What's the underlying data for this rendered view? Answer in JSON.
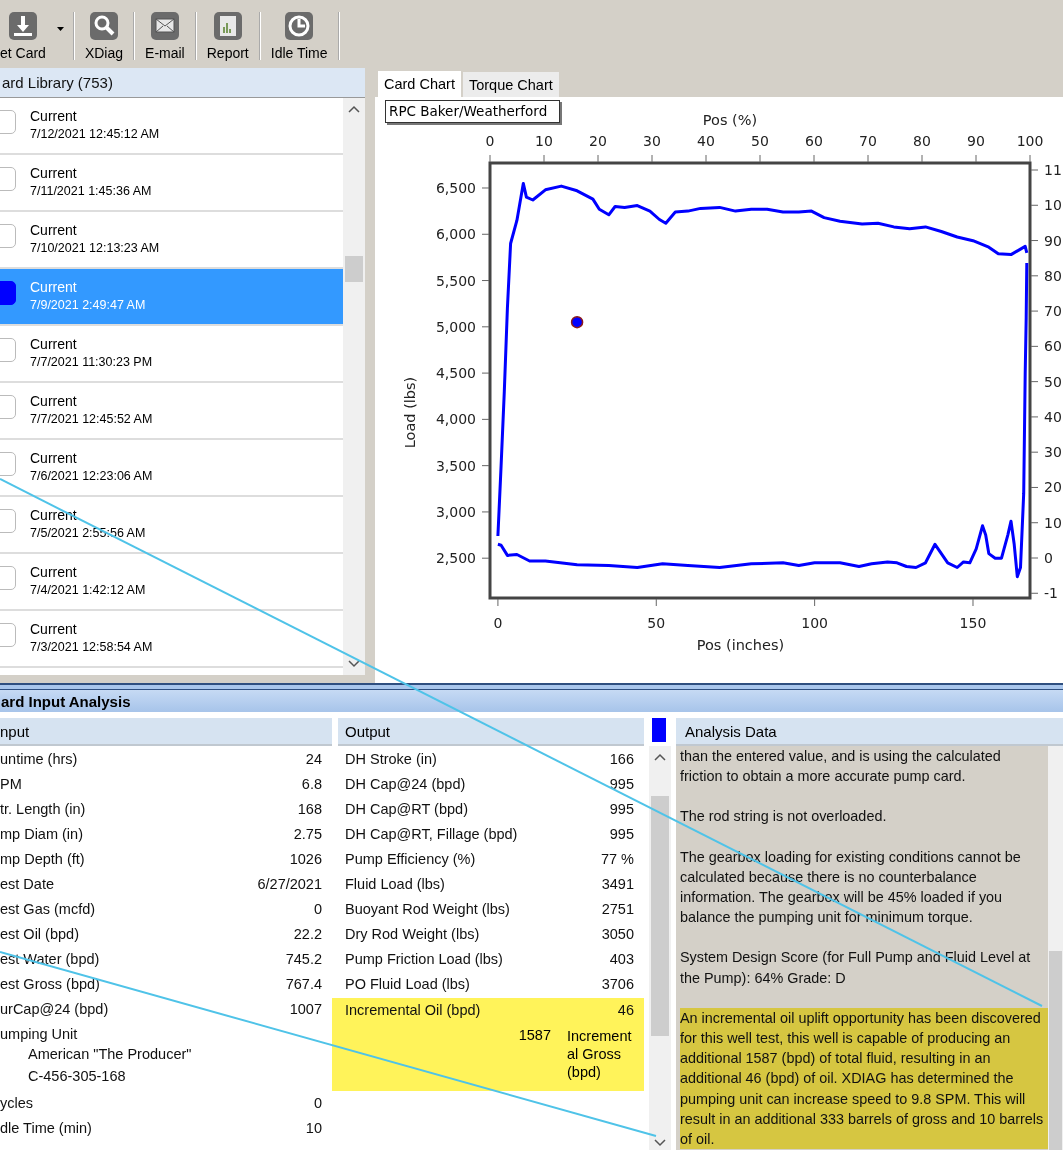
{
  "toolbar": {
    "buttons": [
      {
        "label": "et Card",
        "kind": "download",
        "dropdown": true
      },
      {
        "label": "XDiag",
        "kind": "search",
        "dropdown": false
      },
      {
        "label": "E-mail",
        "kind": "mail",
        "dropdown": false
      },
      {
        "label": "Report",
        "kind": "report",
        "dropdown": false
      },
      {
        "label": "Idle Time",
        "kind": "clock",
        "dropdown": false
      }
    ]
  },
  "library": {
    "title": "ard Library  (753)",
    "items": [
      {
        "label": "Current",
        "date": "7/12/2021 12:45:12 AM",
        "selected": false
      },
      {
        "label": "Current",
        "date": "7/11/2021 1:45:36 AM",
        "selected": false
      },
      {
        "label": "Current",
        "date": "7/10/2021 12:13:23 AM",
        "selected": false
      },
      {
        "label": "Current",
        "date": "7/9/2021 2:49:47 AM",
        "selected": true
      },
      {
        "label": "Current",
        "date": "7/7/2021 11:30:23 PM",
        "selected": false
      },
      {
        "label": "Current",
        "date": "7/7/2021 12:45:52 AM",
        "selected": false
      },
      {
        "label": "Current",
        "date": "7/6/2021 12:23:06 AM",
        "selected": false
      },
      {
        "label": "Current",
        "date": "7/5/2021 2:55:56 AM",
        "selected": false
      },
      {
        "label": "Current",
        "date": "7/4/2021 1:42:12 AM",
        "selected": false
      },
      {
        "label": "Current",
        "date": "7/3/2021 12:58:54 AM",
        "selected": false
      }
    ]
  },
  "chart_tabs": [
    {
      "label": "Card Chart",
      "selected": true
    },
    {
      "label": "Torque Chart",
      "selected": false
    }
  ],
  "chart": {
    "legend": "RPC Baker/Weatherford",
    "chart_data": {
      "type": "line",
      "xlabel": "Pos (inches)",
      "ylabel": "Load (lbs)",
      "x": [
        0,
        1,
        2,
        3,
        4,
        6,
        8,
        9,
        10,
        11,
        15,
        20,
        25,
        30,
        32,
        35,
        37,
        40,
        44,
        48,
        51,
        52,
        53,
        56,
        60,
        64,
        70,
        75,
        80,
        85,
        90,
        95,
        99,
        100,
        103,
        108,
        114,
        115,
        118,
        120,
        123,
        125,
        126,
        129,
        130,
        132,
        135,
        138,
        140,
        142,
        145,
        147,
        149,
        150,
        151,
        153,
        154,
        155,
        157,
        158,
        159,
        161,
        162,
        163,
        164,
        165,
        166,
        166.5,
        166.8,
        167
      ],
      "series": [
        {
          "color": "#0000ff",
          "values": [
            2740,
            3500,
            4300,
            5200,
            5900,
            6150,
            6550,
            6400,
            null,
            6370,
            6480,
            6520,
            6470,
            6380,
            6270,
            6210,
            6300,
            6290,
            6310,
            6250,
            6160,
            null,
            6120,
            6240,
            6250,
            6280,
            6290,
            6250,
            6270,
            6270,
            6240,
            6240,
            6250,
            null,
            6180,
            6140,
            null,
            6110,
            null,
            6120,
            null,
            6080,
            null,
            null,
            6060,
            null,
            6080,
            null,
            6030,
            null,
            5970,
            null,
            null,
            5930,
            null,
            null,
            null,
            5860,
            null,
            5790,
            null,
            null,
            5780,
            null,
            null,
            5840,
            null,
            5870,
            null,
            5800
          ]
        },
        {
          "color": "#0000ff",
          "values": [
            2650,
            2640,
            null,
            2530,
            null,
            2540,
            null,
            null,
            2470,
            null,
            2470,
            null,
            2430,
            null,
            null,
            2420,
            null,
            null,
            2400,
            null,
            null,
            2440,
            null,
            null,
            2420,
            null,
            2400,
            null,
            2440,
            null,
            2450,
            2420,
            null,
            2450,
            null,
            2450,
            2410,
            null,
            2440,
            null,
            2460,
            null,
            2450,
            2410,
            null,
            2400,
            2450,
            2650,
            null,
            2450,
            2400,
            2460,
            2450,
            null,
            2600,
            2850,
            2750,
            2550,
            2500,
            null,
            2500,
            2750,
            2900,
            2650,
            2300,
            2400,
            3200,
            4500,
            5100,
            5690
          ]
        }
      ],
      "xlim": [
        -2.5,
        168
      ],
      "ylim": [
        2070,
        6770
      ],
      "xticks": [
        0,
        50,
        100,
        150
      ],
      "yticks": [
        {
          "value": 2500,
          "label": "2,500"
        },
        {
          "value": 3000,
          "label": "3,000"
        },
        {
          "value": 3500,
          "label": "3,500"
        },
        {
          "value": 4000,
          "label": "4,000"
        },
        {
          "value": 4500,
          "label": "4,500"
        },
        {
          "value": 5000,
          "label": "5,000"
        },
        {
          "value": 5500,
          "label": "5,500"
        },
        {
          "value": 6000,
          "label": "6,000"
        },
        {
          "value": 6500,
          "label": "6,500"
        }
      ]
    },
    "top_axis": {
      "label": "Pos (%)",
      "ticks": [
        "0",
        "10",
        "20",
        "30",
        "40",
        "50",
        "60",
        "70",
        "80",
        "90",
        "100"
      ]
    },
    "right_axis": {
      "ticks": [
        "11",
        "10",
        "90",
        "80",
        "70",
        "60",
        "50",
        "40",
        "30",
        "20",
        "10",
        "0",
        "-1"
      ]
    }
  },
  "analysis": {
    "title": "ard Input Analysis",
    "input": {
      "header": "nput",
      "rows": [
        {
          "kind": "value",
          "label": "untime (hrs)",
          "value": "24"
        },
        {
          "kind": "value",
          "label": "PM",
          "value": "6.8"
        },
        {
          "kind": "value",
          "label": "tr. Length (in)",
          "value": "168"
        },
        {
          "kind": "value",
          "label": "mp Diam (in)",
          "value": "2.75"
        },
        {
          "kind": "value",
          "label": "mp Depth (ft)",
          "value": "1026"
        },
        {
          "kind": "value",
          "label": "est Date",
          "value": "6/27/2021"
        },
        {
          "kind": "value",
          "label": "est Gas (mcfd)",
          "value": "0"
        },
        {
          "kind": "value",
          "label": "est Oil (bpd)",
          "value": "22.2"
        },
        {
          "kind": "value",
          "label": "est Water (bpd)",
          "value": "745.2"
        },
        {
          "kind": "value",
          "label": "est Gross (bpd)",
          "value": "767.4"
        },
        {
          "kind": "value",
          "label": "urCap@24 (bpd)",
          "value": "1007"
        },
        {
          "kind": "group",
          "label": "umping Unit",
          "details": [
            "American \"The Producer\"",
            "C-456-305-168"
          ]
        },
        {
          "kind": "value",
          "label": "ycles",
          "value": "0"
        },
        {
          "kind": "value",
          "label": "dle Time (min)",
          "value": "10"
        }
      ]
    },
    "output": {
      "header": "Output",
      "rows": [
        {
          "label": "DH Stroke (in)",
          "value": "166"
        },
        {
          "label": "DH Cap@24 (bpd)",
          "value": "995"
        },
        {
          "label": "DH Cap@RT (bpd)",
          "value": "995"
        },
        {
          "label": "DH Cap@RT, Fillage (bpd)",
          "value": "995"
        },
        {
          "label": "Pump Efficiency (%)",
          "value": "77 %"
        },
        {
          "label": "Fluid Load (lbs)",
          "value": "3491"
        },
        {
          "label": "Buoyant Rod Weight (lbs)",
          "value": "2751"
        },
        {
          "label": "Dry Rod Weight (lbs)",
          "value": "3050"
        },
        {
          "label": "Pump Friction Load (lbs)",
          "value": "403"
        },
        {
          "label": "PO Fluid Load  (lbs)",
          "value": "3706"
        }
      ],
      "highlight": {
        "label": "Incremental Oil (bpd)",
        "value": "46",
        "sub_value": "1587",
        "sub_label": "Incremental Gross (bpd)"
      }
    },
    "analysis_data": {
      "header": "Analysis Data",
      "paragraphs": [
        {
          "text": "than the entered value, and is using the calculated friction to obtain a more accurate pump card.",
          "highlighted": false
        },
        {
          "text": "The rod string is not overloaded.",
          "highlighted": false
        },
        {
          "text": "The gearbox loading for existing conditions cannot be calculated because there is no counterbalance information.  The gearbox will be 45% loaded if you balance the pumping unit for minimum torque.",
          "highlighted": false
        },
        {
          "text": "System Design Score (for Full Pump and Fluid Level at the Pump): 64%  Grade: D",
          "highlighted": false
        },
        {
          "text": "An incremental oil uplift opportunity has been discovered for this well test, this well is capable of producing an additional 1587 (bpd) of total fluid, resulting in an additional 46 (bpd) of oil. XDIAG has determined the pumping unit can increase speed to 9.8 SPM. This will result in an additional 333 barrels of gross and 10 barrels of oil.",
          "highlighted": true
        }
      ]
    }
  }
}
